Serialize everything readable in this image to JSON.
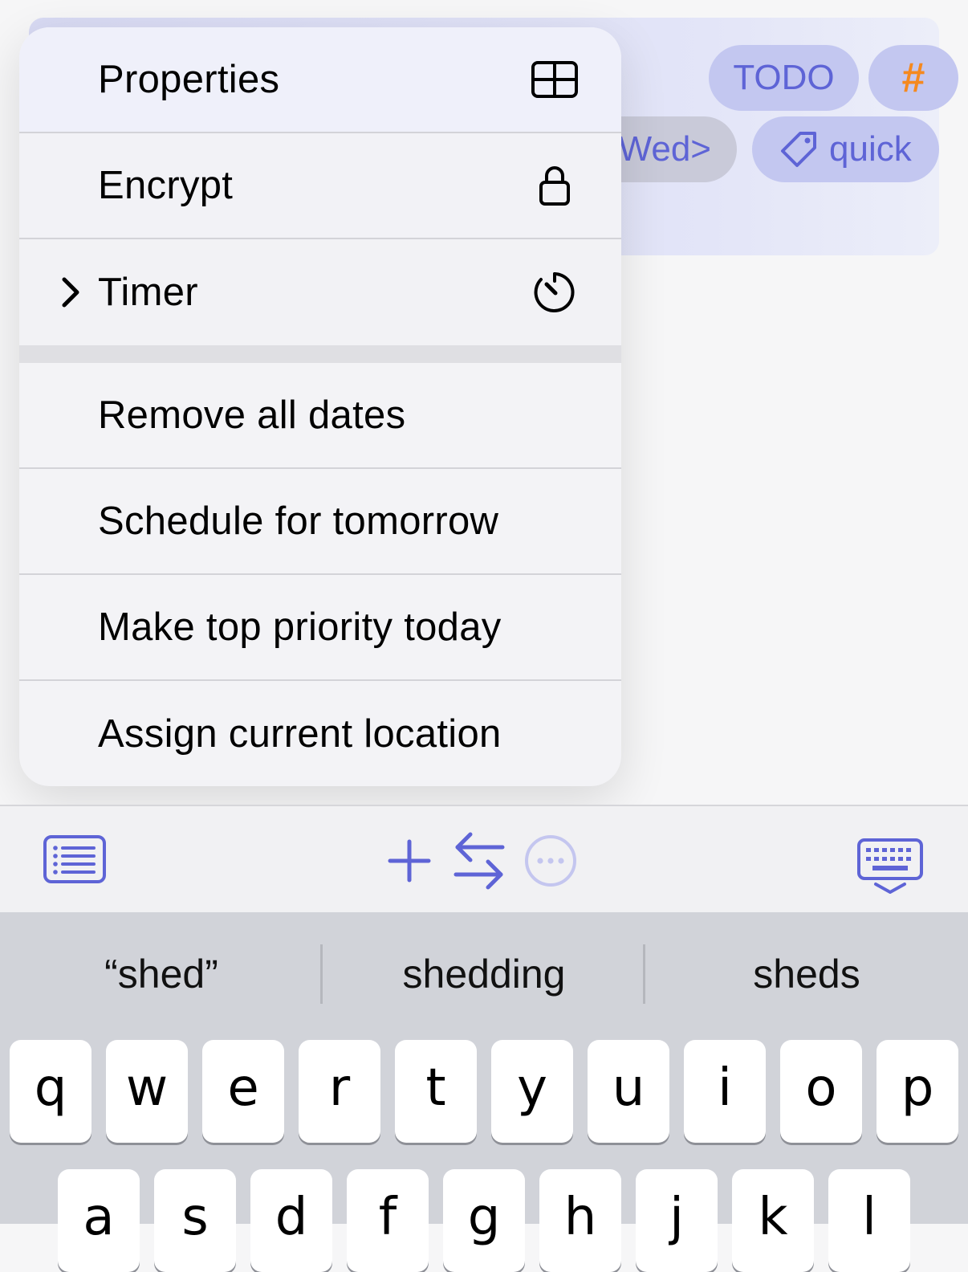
{
  "note_card": {
    "chips": {
      "todo": "TODO",
      "hash": "#",
      "date": "Wed>",
      "tag": "quick"
    },
    "colors": {
      "accent": "#5e64d6",
      "hash": "#f5891f",
      "chip_bg": "#c3c7f0"
    }
  },
  "menu": {
    "items": [
      {
        "label": "Properties",
        "icon": "table-icon"
      },
      {
        "label": "Encrypt",
        "icon": "lock-icon"
      },
      {
        "label": "Timer",
        "icon": "timer-icon",
        "submenu": true
      },
      {
        "label": "Remove all dates"
      },
      {
        "label": "Schedule for tomorrow"
      },
      {
        "label": "Make top priority today"
      },
      {
        "label": "Assign current location"
      }
    ]
  },
  "toolbar": {
    "buttons": [
      "outline-list-icon",
      "add-icon",
      "swap-icon",
      "more-icon",
      "keyboard-dismiss-icon"
    ]
  },
  "keyboard": {
    "suggestions": [
      "“shed”",
      "shedding",
      "sheds"
    ],
    "row1": [
      "q",
      "w",
      "e",
      "r",
      "t",
      "y",
      "u",
      "i",
      "o",
      "p"
    ],
    "row2": [
      "a",
      "s",
      "d",
      "f",
      "g",
      "h",
      "j",
      "k",
      "l"
    ]
  }
}
